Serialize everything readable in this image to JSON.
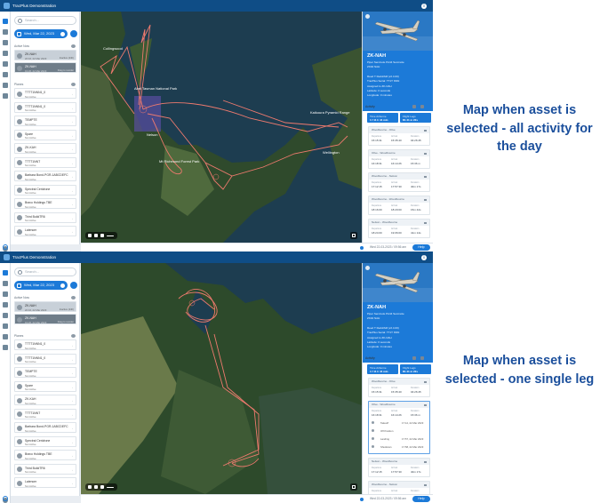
{
  "app_title": "TracPlus Demonstration",
  "search_placeholder": "Search...",
  "date_label": "Wed, Mar 22, 2023",
  "active_now_label": "Active Now",
  "planes_label": "Planes",
  "active_assets": [
    {
      "name": "ZK-NAH",
      "sub": "22:16, 22 Mar 2023",
      "right": "Inactive (24h)"
    },
    {
      "name": "ZK-NAH",
      "sub": "19:26, 22 Mar 2023",
      "right": "Drag to reorder"
    }
  ],
  "planes": [
    {
      "name": "TTTT1NNN1_0",
      "sub": "Not Active"
    },
    {
      "name": "TTTT1NNN1_0",
      "sub": "Not Active"
    },
    {
      "name": "TEMPTE",
      "sub": "Not Active"
    },
    {
      "name": "Spare",
      "sub": "Not Active"
    },
    {
      "name": "ZK-KAH",
      "sub": "Not Active"
    },
    {
      "name": "TTTT1NNT",
      "sub": "Not Active"
    },
    {
      "name": "Barbara Bond-PGR-1ABCDEFC",
      "sub": "Not Active"
    },
    {
      "name": "Spectral Ceridrone",
      "sub": "Not Active"
    },
    {
      "name": "Bravo Holdings TBE",
      "sub": "Not Active"
    },
    {
      "name": "Third BuildTR6",
      "sub": "Not Active"
    },
    {
      "name": "Latencer",
      "sub": "Not Active"
    }
  ],
  "map_labels": {
    "park1": "Abel Tasman National Park",
    "park2": "Mt Richmond Forest Park",
    "park3": "Kaikoura Pyramid Range",
    "city": "Nelson",
    "wellington": "Wellington",
    "north": "Collingwood"
  },
  "asset": {
    "reg": "ZK-NAH",
    "model": "Piper Seminole PA44 Seminole",
    "id": "ZK94 NAH",
    "last_fix": "Reed T Redd/AM (v2.4.00)",
    "device": "TracPlus Serial: TT1T NNN",
    "coords_hd": "Assigned to ZK-NAH",
    "lat": "Latitude: 0 seconds",
    "lon": "Longitude: 0 minutes"
  },
  "activity_label": "Activity",
  "tiles": [
    {
      "label": "Time Airborne",
      "value": "1 f 11 h 44 min"
    },
    {
      "label": "Flight Legs",
      "value": "8h 41 m 22s"
    }
  ],
  "legs1": [
    {
      "title": "Woodbourne - Olive",
      "a": "15:15:31",
      "b": "15:35:40",
      "c": "04:26:45"
    },
    {
      "title": "Olive - Woodbourne",
      "a": "16:18:31",
      "b": "16:14:26",
      "c": "15:36 m"
    },
    {
      "title": "Woodbourne - Nelson",
      "a": "17:12:15",
      "b": "17:57:30",
      "c": "40m 17s"
    },
    {
      "title": "Woodbourne - Woodbourne",
      "a": "18:16:00",
      "b": "18:20:00",
      "c": "15m 42s"
    },
    {
      "title": "Nelson - Woodbourne",
      "a": "18:24:00",
      "b": "19:06:00",
      "c": "41m 14s"
    }
  ],
  "legs2": [
    {
      "title": "Woodbourne - Olive",
      "a": "15:15:31",
      "b": "15:35:40",
      "c": "04:26:45"
    },
    {
      "title": "Olive - Woodbourne",
      "a": "16:18:31",
      "b": "16:14:26",
      "c": "15:36 m"
    },
    {
      "title": "Nelson - Woodbourne",
      "a": "17:12:15",
      "b": "17:57:30",
      "c": "40m 17s"
    },
    {
      "title": "Woodbourne - Nelson",
      "a": "18:16:00",
      "b": "18:20:00",
      "c": "15m 42s"
    }
  ],
  "leg_detail": [
    {
      "name": "Takeoff",
      "time": "17:12, 22 Mar 2023"
    },
    {
      "name": "Off Position",
      "time": ""
    },
    {
      "name": "Landing",
      "time": "17:57, 22 Mar 2023"
    },
    {
      "name": "Shutdown",
      "time": "17:58, 22 Mar 2023"
    }
  ],
  "col_depart": "Departure",
  "col_arrive": "Arrival",
  "col_dur": "Duration",
  "footer_time": "Wed 22-03-2023 / 09:56 am",
  "help_label": "Help",
  "caption1": "Map when asset is selected - all activity for the day",
  "caption2": "Map when asset is selected - one single leg"
}
